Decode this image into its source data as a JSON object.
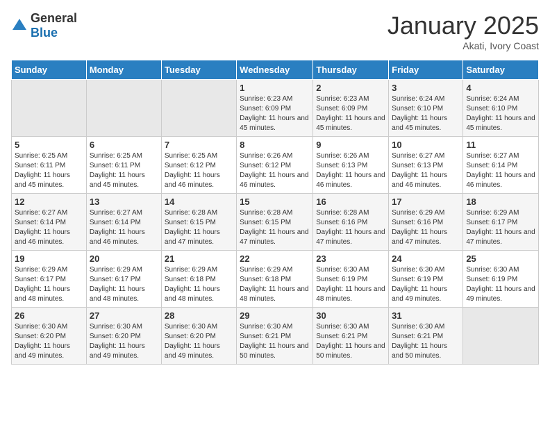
{
  "logo": {
    "general": "General",
    "blue": "Blue"
  },
  "header": {
    "month": "January 2025",
    "location": "Akati, Ivory Coast"
  },
  "days_of_week": [
    "Sunday",
    "Monday",
    "Tuesday",
    "Wednesday",
    "Thursday",
    "Friday",
    "Saturday"
  ],
  "weeks": [
    [
      {
        "day": "",
        "info": ""
      },
      {
        "day": "",
        "info": ""
      },
      {
        "day": "",
        "info": ""
      },
      {
        "day": "1",
        "info": "Sunrise: 6:23 AM\nSunset: 6:09 PM\nDaylight: 11 hours and 45 minutes."
      },
      {
        "day": "2",
        "info": "Sunrise: 6:23 AM\nSunset: 6:09 PM\nDaylight: 11 hours and 45 minutes."
      },
      {
        "day": "3",
        "info": "Sunrise: 6:24 AM\nSunset: 6:10 PM\nDaylight: 11 hours and 45 minutes."
      },
      {
        "day": "4",
        "info": "Sunrise: 6:24 AM\nSunset: 6:10 PM\nDaylight: 11 hours and 45 minutes."
      }
    ],
    [
      {
        "day": "5",
        "info": "Sunrise: 6:25 AM\nSunset: 6:11 PM\nDaylight: 11 hours and 45 minutes."
      },
      {
        "day": "6",
        "info": "Sunrise: 6:25 AM\nSunset: 6:11 PM\nDaylight: 11 hours and 45 minutes."
      },
      {
        "day": "7",
        "info": "Sunrise: 6:25 AM\nSunset: 6:12 PM\nDaylight: 11 hours and 46 minutes."
      },
      {
        "day": "8",
        "info": "Sunrise: 6:26 AM\nSunset: 6:12 PM\nDaylight: 11 hours and 46 minutes."
      },
      {
        "day": "9",
        "info": "Sunrise: 6:26 AM\nSunset: 6:13 PM\nDaylight: 11 hours and 46 minutes."
      },
      {
        "day": "10",
        "info": "Sunrise: 6:27 AM\nSunset: 6:13 PM\nDaylight: 11 hours and 46 minutes."
      },
      {
        "day": "11",
        "info": "Sunrise: 6:27 AM\nSunset: 6:14 PM\nDaylight: 11 hours and 46 minutes."
      }
    ],
    [
      {
        "day": "12",
        "info": "Sunrise: 6:27 AM\nSunset: 6:14 PM\nDaylight: 11 hours and 46 minutes."
      },
      {
        "day": "13",
        "info": "Sunrise: 6:27 AM\nSunset: 6:14 PM\nDaylight: 11 hours and 46 minutes."
      },
      {
        "day": "14",
        "info": "Sunrise: 6:28 AM\nSunset: 6:15 PM\nDaylight: 11 hours and 47 minutes."
      },
      {
        "day": "15",
        "info": "Sunrise: 6:28 AM\nSunset: 6:15 PM\nDaylight: 11 hours and 47 minutes."
      },
      {
        "day": "16",
        "info": "Sunrise: 6:28 AM\nSunset: 6:16 PM\nDaylight: 11 hours and 47 minutes."
      },
      {
        "day": "17",
        "info": "Sunrise: 6:29 AM\nSunset: 6:16 PM\nDaylight: 11 hours and 47 minutes."
      },
      {
        "day": "18",
        "info": "Sunrise: 6:29 AM\nSunset: 6:17 PM\nDaylight: 11 hours and 47 minutes."
      }
    ],
    [
      {
        "day": "19",
        "info": "Sunrise: 6:29 AM\nSunset: 6:17 PM\nDaylight: 11 hours and 48 minutes."
      },
      {
        "day": "20",
        "info": "Sunrise: 6:29 AM\nSunset: 6:17 PM\nDaylight: 11 hours and 48 minutes."
      },
      {
        "day": "21",
        "info": "Sunrise: 6:29 AM\nSunset: 6:18 PM\nDaylight: 11 hours and 48 minutes."
      },
      {
        "day": "22",
        "info": "Sunrise: 6:29 AM\nSunset: 6:18 PM\nDaylight: 11 hours and 48 minutes."
      },
      {
        "day": "23",
        "info": "Sunrise: 6:30 AM\nSunset: 6:19 PM\nDaylight: 11 hours and 48 minutes."
      },
      {
        "day": "24",
        "info": "Sunrise: 6:30 AM\nSunset: 6:19 PM\nDaylight: 11 hours and 49 minutes."
      },
      {
        "day": "25",
        "info": "Sunrise: 6:30 AM\nSunset: 6:19 PM\nDaylight: 11 hours and 49 minutes."
      }
    ],
    [
      {
        "day": "26",
        "info": "Sunrise: 6:30 AM\nSunset: 6:20 PM\nDaylight: 11 hours and 49 minutes."
      },
      {
        "day": "27",
        "info": "Sunrise: 6:30 AM\nSunset: 6:20 PM\nDaylight: 11 hours and 49 minutes."
      },
      {
        "day": "28",
        "info": "Sunrise: 6:30 AM\nSunset: 6:20 PM\nDaylight: 11 hours and 49 minutes."
      },
      {
        "day": "29",
        "info": "Sunrise: 6:30 AM\nSunset: 6:21 PM\nDaylight: 11 hours and 50 minutes."
      },
      {
        "day": "30",
        "info": "Sunrise: 6:30 AM\nSunset: 6:21 PM\nDaylight: 11 hours and 50 minutes."
      },
      {
        "day": "31",
        "info": "Sunrise: 6:30 AM\nSunset: 6:21 PM\nDaylight: 11 hours and 50 minutes."
      },
      {
        "day": "",
        "info": ""
      }
    ]
  ]
}
